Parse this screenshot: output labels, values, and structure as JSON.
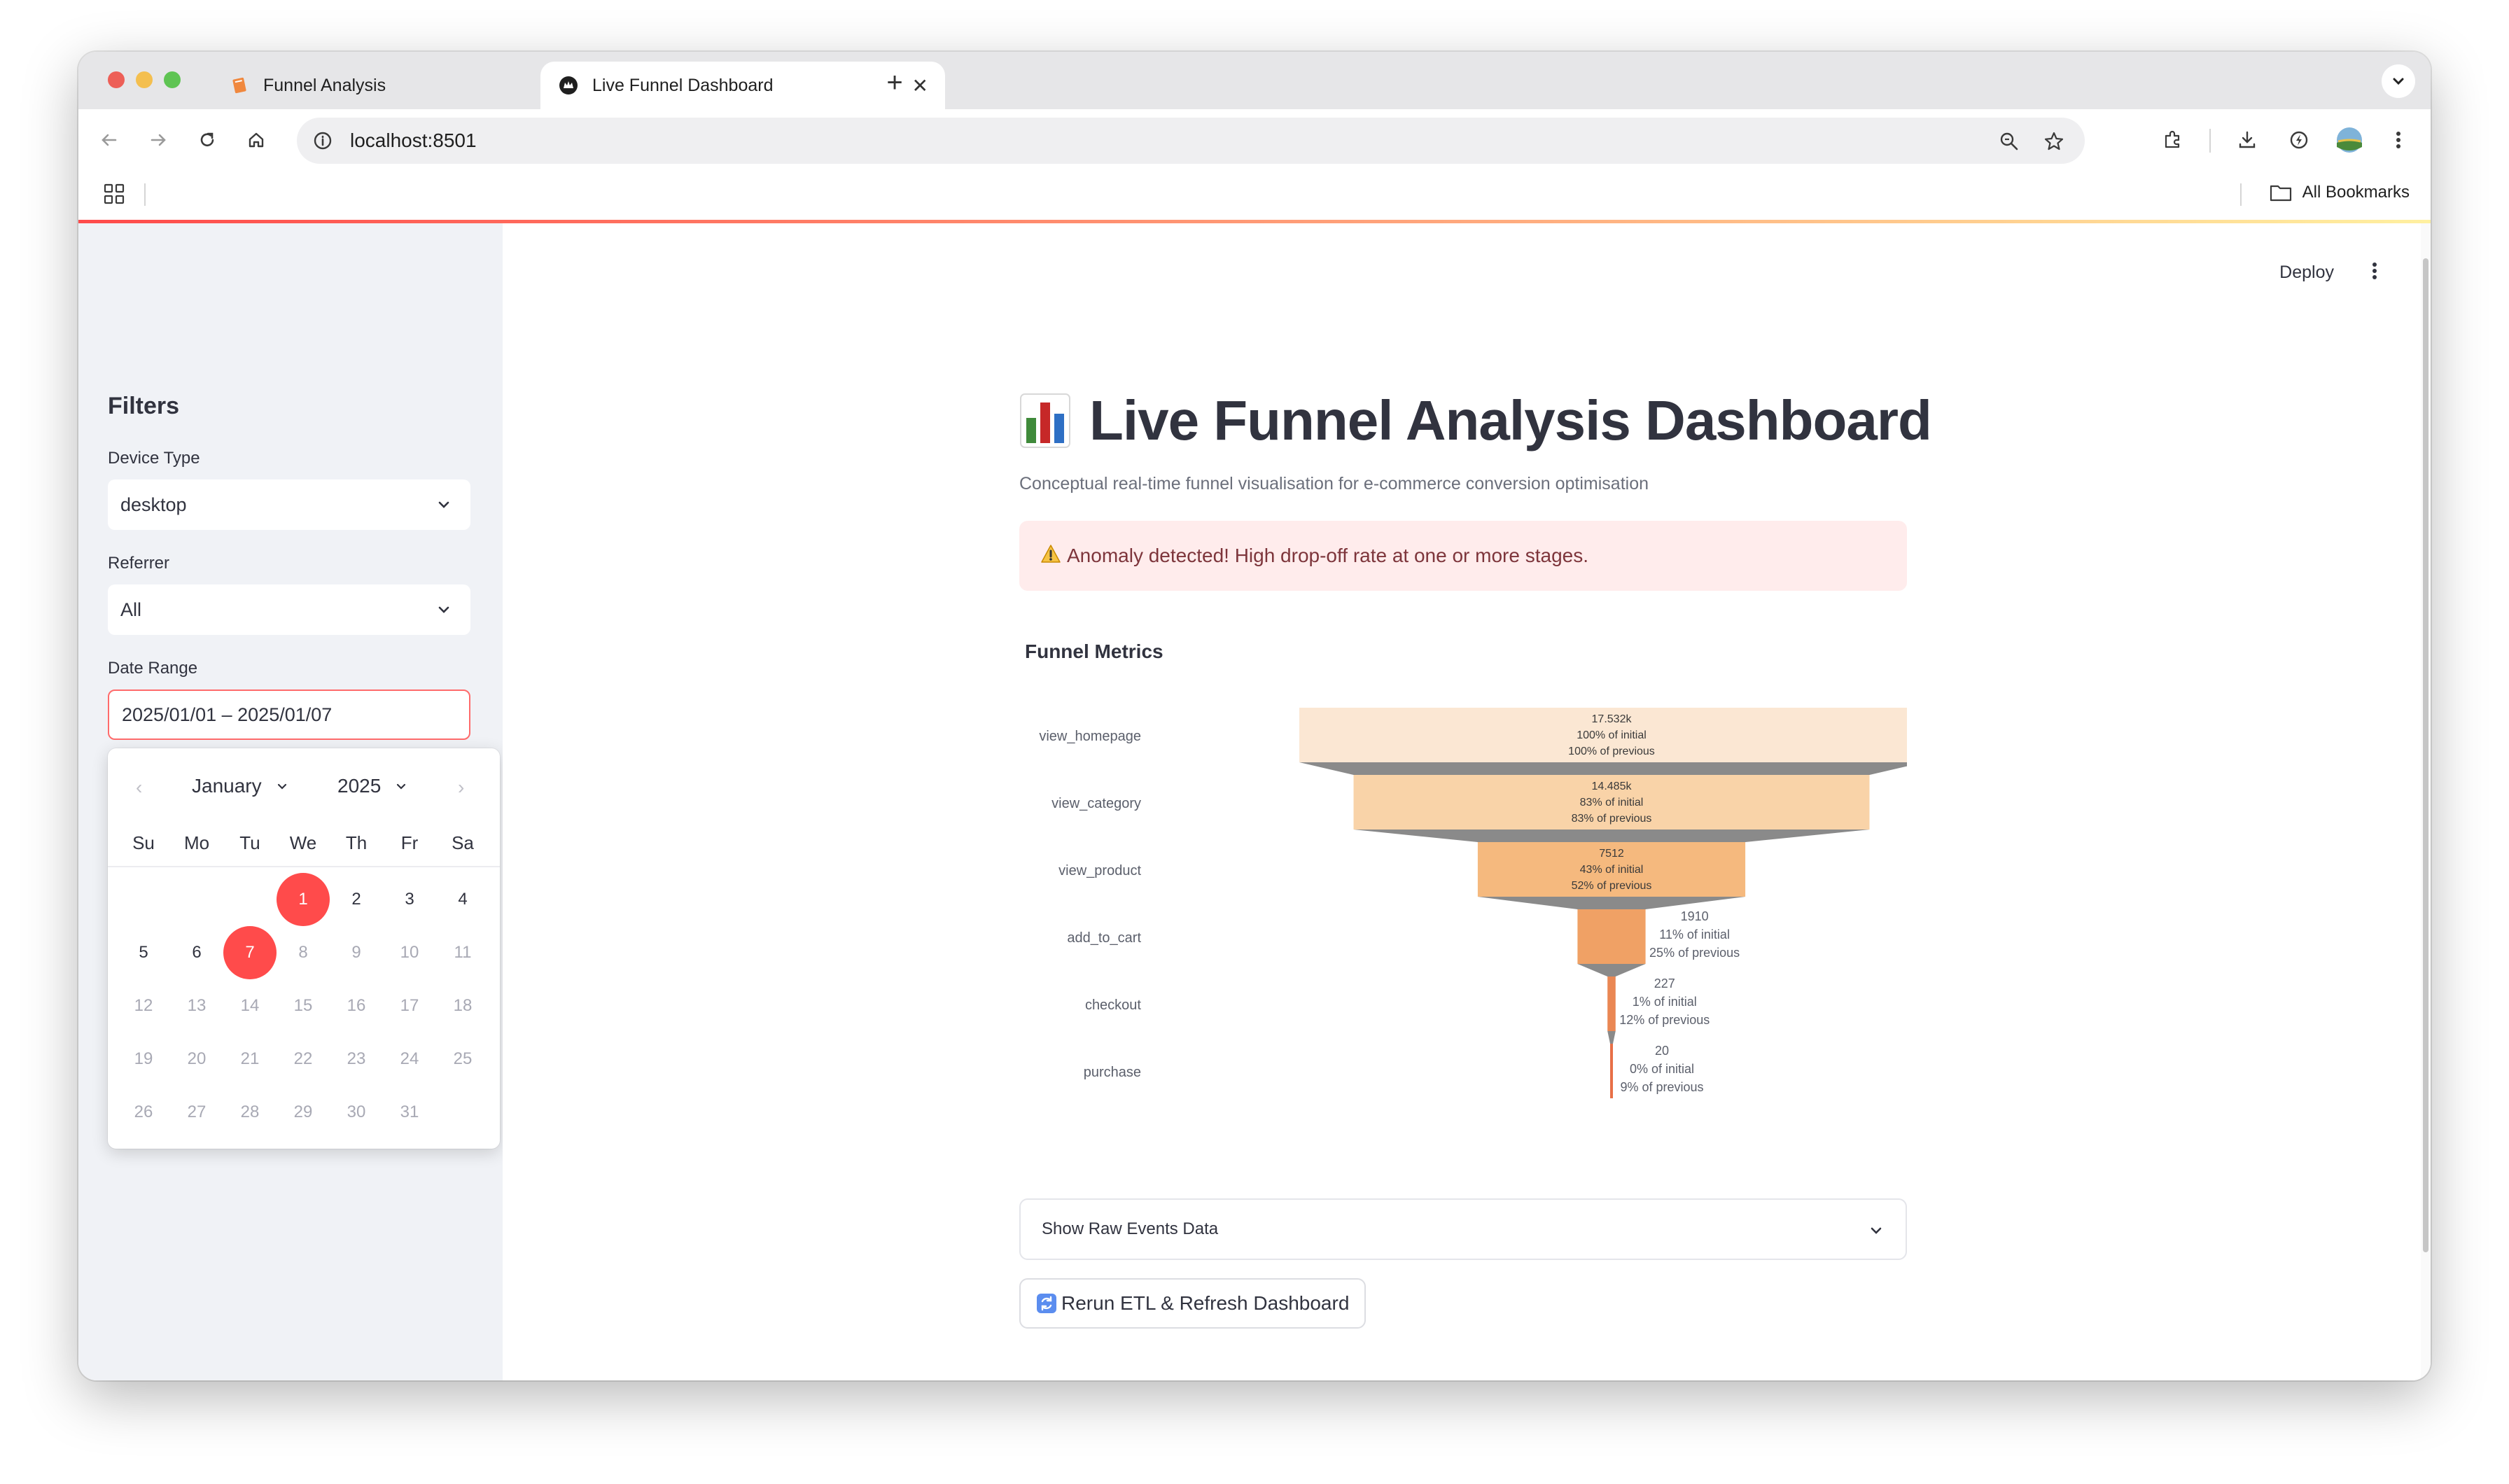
{
  "browser": {
    "tabs": [
      {
        "title": "Funnel Analysis"
      },
      {
        "title": "Live Funnel Dashboard"
      }
    ],
    "url": "localhost:8501",
    "bookmarks_label": "All Bookmarks"
  },
  "app": {
    "deploy_label": "Deploy"
  },
  "sidebar": {
    "title": "Filters",
    "device_type": {
      "label": "Device Type",
      "value": "desktop"
    },
    "referrer": {
      "label": "Referrer",
      "value": "All"
    },
    "date_range": {
      "label": "Date Range",
      "value": "2025/01/01 – 2025/01/07"
    },
    "calendar": {
      "month": "January",
      "year": "2025",
      "weekdays": [
        "Su",
        "Mo",
        "Tu",
        "We",
        "Th",
        "Fr",
        "Sa"
      ],
      "first_weekday_index": 3,
      "days_in_month": 31,
      "selected_start": 1,
      "selected_end": 7
    }
  },
  "main": {
    "title": "Live Funnel Analysis Dashboard",
    "subtitle": "Conceptual real-time funnel visualisation for e-commerce conversion optimisation",
    "alert": "Anomaly detected! High drop-off rate at one or more stages.",
    "section_title": "Funnel Metrics",
    "expander_label": "Show Raw Events Data",
    "rerun_label": "Rerun ETL & Refresh Dashboard"
  },
  "chart_data": {
    "type": "funnel",
    "categories": [
      "view_homepage",
      "view_category",
      "view_product",
      "add_to_cart",
      "checkout",
      "purchase"
    ],
    "values": [
      17532,
      14485,
      7512,
      1910,
      227,
      20
    ],
    "value_labels": [
      "17.532k",
      "14.485k",
      "7512",
      "1910",
      "227",
      "20"
    ],
    "pct_initial_labels": [
      "100% of initial",
      "83% of initial",
      "43% of initial",
      "11% of initial",
      "1% of initial",
      "0% of initial"
    ],
    "pct_previous_labels": [
      "100% of previous",
      "83% of previous",
      "52% of previous",
      "25% of previous",
      "12% of previous",
      "9% of previous"
    ],
    "colors": [
      "#fbe7d3",
      "#f9d3a8",
      "#f5b97e",
      "#f0a165",
      "#ea8753",
      "#e87047"
    ],
    "connector_color": "#8a8a8a"
  }
}
